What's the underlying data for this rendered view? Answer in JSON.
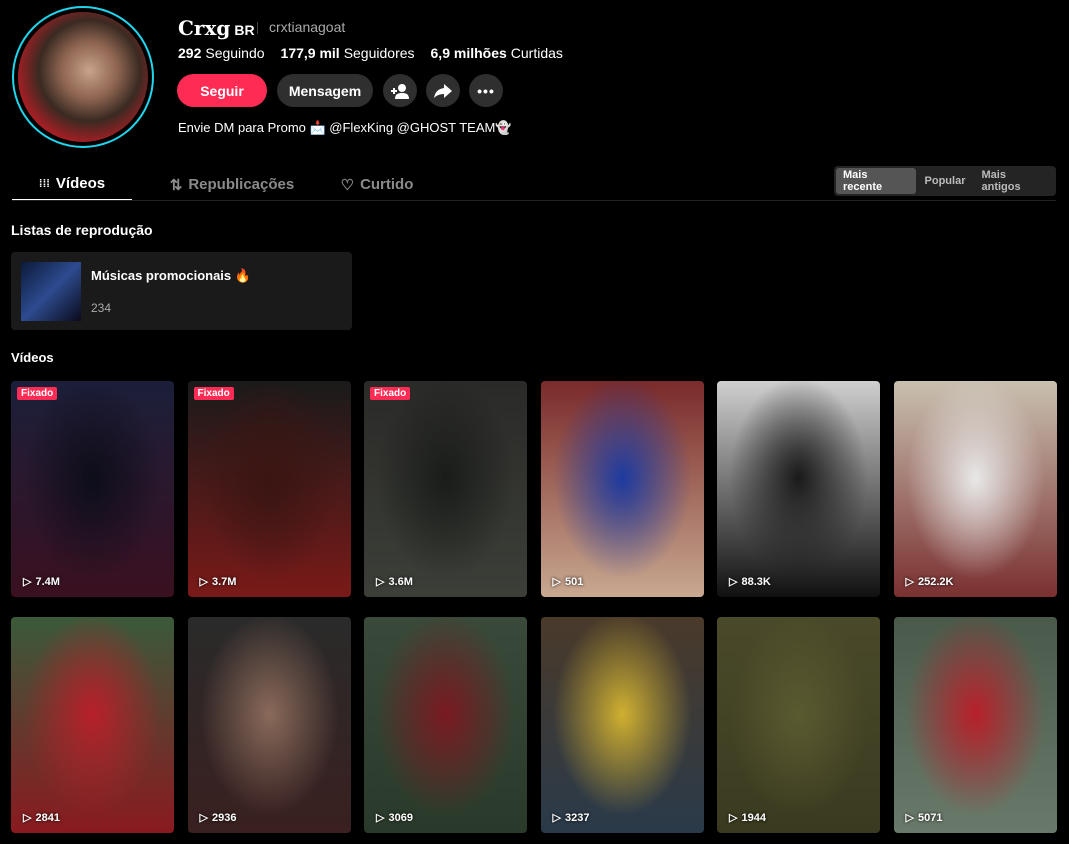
{
  "profile": {
    "name": "Crxg",
    "badge": "BR",
    "handle": "crxtianagoat",
    "bio": "Envie DM para Promo 📩 @FlexKing @GHOST TEAM👻",
    "stats": [
      {
        "value": "292",
        "label": "Seguindo"
      },
      {
        "value": "177,9 mil",
        "label": "Seguidores"
      },
      {
        "value": "6,9 milhões",
        "label": "Curtidas"
      }
    ],
    "follow_label": "Seguir",
    "message_label": "Mensagem"
  },
  "tabs": [
    {
      "label": "Vídeos",
      "icon": "grid-icon"
    },
    {
      "label": "Republicações",
      "icon": "repost-icon"
    },
    {
      "label": "Curtido",
      "icon": "heart-icon"
    }
  ],
  "sort": [
    "Mais recente",
    "Popular",
    "Mais antigos"
  ],
  "playlists_heading": "Listas de reprodução",
  "playlist": {
    "title": "Músicas promocionais 🔥",
    "count": "234"
  },
  "videos_heading": "Vídeos",
  "pinned_label": "Fixado",
  "videos": [
    {
      "views": "7.4M",
      "pinned": true,
      "c": [
        "#1b1f3a",
        "#0d0d1a",
        "#3a1020"
      ]
    },
    {
      "views": "3.7M",
      "pinned": true,
      "c": [
        "#1a1a1a",
        "#3a1512",
        "#7a1a18"
      ]
    },
    {
      "views": "3.6M",
      "pinned": true,
      "c": [
        "#2a2a28",
        "#1a1c1a",
        "#3c3f38"
      ]
    },
    {
      "views": "501",
      "pinned": false,
      "c": [
        "#7a2a2a",
        "#1d3aa0",
        "#c8a890"
      ]
    },
    {
      "views": "88.3K",
      "pinned": false,
      "c": [
        "#cfcfcf",
        "#1a1a1a",
        "#101010"
      ]
    },
    {
      "views": "252.2K",
      "pinned": false,
      "c": [
        "#c9c0b0",
        "#e8e8e8",
        "#7a3030"
      ]
    },
    {
      "views": "2841",
      "pinned": false,
      "c": [
        "#3a5a3a",
        "#b8202a",
        "#8a1a20"
      ]
    },
    {
      "views": "2936",
      "pinned": false,
      "c": [
        "#2a2a2a",
        "#8a6a5a",
        "#3a2020"
      ]
    },
    {
      "views": "3069",
      "pinned": false,
      "c": [
        "#3a4a3a",
        "#7a1a20",
        "#2a3a2a"
      ]
    },
    {
      "views": "3237",
      "pinned": false,
      "c": [
        "#4a3a2a",
        "#d0b030",
        "#2a3a4a"
      ]
    },
    {
      "views": "1944",
      "pinned": false,
      "c": [
        "#4a4a2a",
        "#5a5a30",
        "#3a3a20"
      ]
    },
    {
      "views": "5071",
      "pinned": false,
      "c": [
        "#4a5a4a",
        "#b8202a",
        "#6a7a6a"
      ]
    }
  ]
}
